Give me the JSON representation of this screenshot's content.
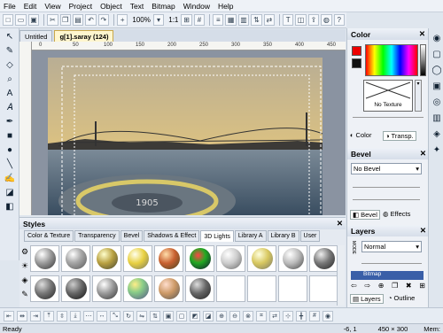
{
  "menu": [
    "File",
    "Edit",
    "View",
    "Project",
    "Object",
    "Text",
    "Bitmap",
    "Window",
    "Help"
  ],
  "toolbar": {
    "zoom": "100%",
    "ratio": "1:1"
  },
  "doc_tabs": [
    "Untitled",
    "g[1].saray (124)"
  ],
  "ruler_ticks": [
    "0",
    "50",
    "100",
    "150",
    "200",
    "250",
    "300",
    "350",
    "400",
    "450"
  ],
  "canvas_text": "1905",
  "color_panel": {
    "title": "Color",
    "no_texture": "No Texture",
    "tab_color": "Color",
    "tab_transp": "Transp."
  },
  "bevel_panel": {
    "title": "Bevel",
    "value": "No Bevel",
    "tab_bevel": "Bevel",
    "tab_effects": "Effects"
  },
  "layers_panel": {
    "title": "Layers",
    "mode": "Normal",
    "mode_label": "MODE",
    "item": "Bitmap",
    "tab_layers": "Layers",
    "tab_outline": "Outline"
  },
  "styles_panel": {
    "title": "Styles",
    "tabs": [
      "Color & Texture",
      "Transparency",
      "Bevel",
      "Shadows & Effect",
      "3D Lights",
      "Library A",
      "Library B",
      "User"
    ],
    "active_tab": "3D Lights"
  },
  "status": {
    "left": "Ready",
    "coords": "-6, 1",
    "size": "450 × 300",
    "mem": "Mem:"
  },
  "colors": {
    "accent": "#c9a84a",
    "panel": "#eef1f6"
  }
}
